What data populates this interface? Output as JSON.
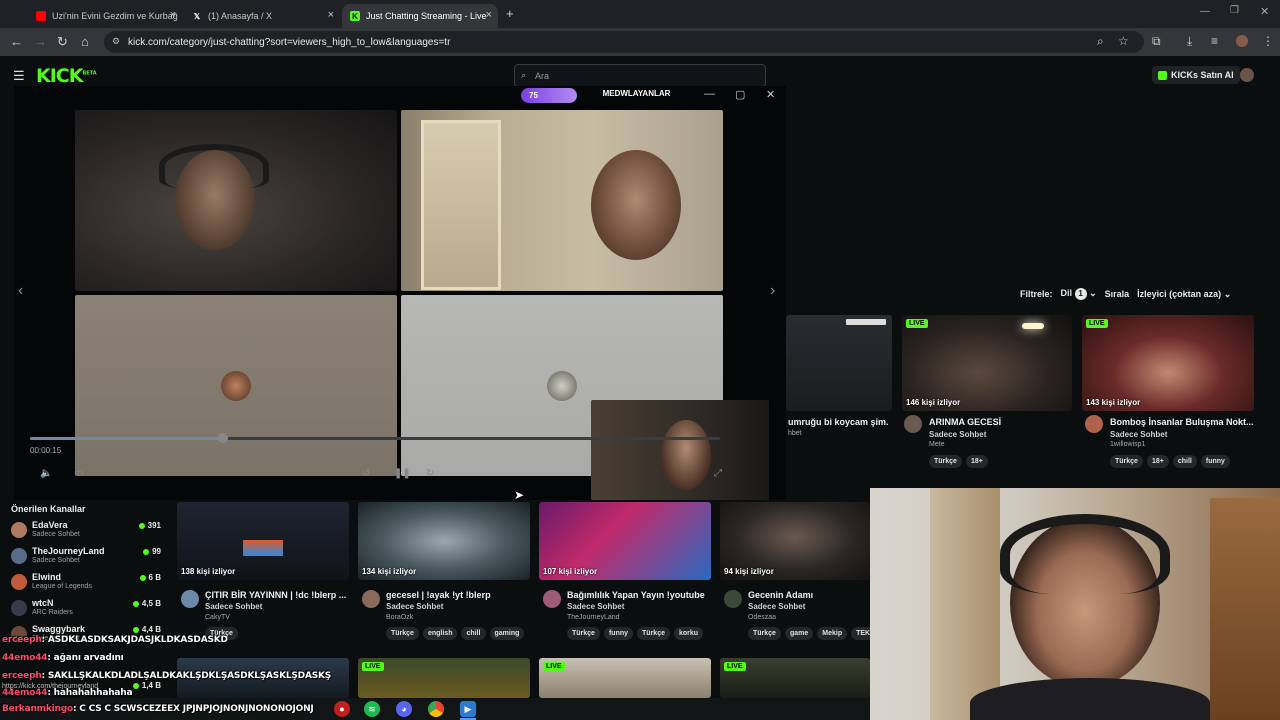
{
  "tabs": [
    {
      "label": "Uzi'nin Evini Gezdim ve Kurbağ",
      "favicon": "youtube-icon"
    },
    {
      "label": "(1) Anasayfa / X",
      "favicon": "x-icon"
    },
    {
      "label": "Just Chatting Streaming - Live",
      "favicon": "kick-icon"
    }
  ],
  "address": {
    "url": "kick.com/category/just-chatting?sort=viewers_high_to_low&languages=tr"
  },
  "kick": {
    "logo": "KICK",
    "logo_sup": "BETA",
    "search_placeholder": "Ara",
    "buy_ai": "KICKs Satın Al"
  },
  "popup": {
    "level_badge": "75",
    "followers_label": "MEDWLAYANLAR",
    "timecode": "00:00:15",
    "progress": 0.28
  },
  "filters": {
    "filter_label": "Filtrele:",
    "lang_label": "Dil",
    "lang_count": "1",
    "sort_label": "Sırala",
    "sort_value": "İzleyici (çoktan aza)"
  },
  "top_cards": [
    {
      "title": "umruğu bi koycam şim...",
      "user": "hbet",
      "category": "",
      "viewers": "",
      "tags": []
    },
    {
      "title": "ARINMA GECESİ",
      "category": "Sadece Sohbet",
      "user": "Mete",
      "viewers": "146 kişi izliyor",
      "live": "LIVE",
      "tags": [
        "Türkçe",
        "18+"
      ]
    },
    {
      "title": "Bomboş İnsanlar Buluşma Nokt...",
      "category": "Sadece Sohbet",
      "user": "1willowisp1",
      "viewers": "143 kişi izliyor",
      "live": "LIVE",
      "tags": [
        "Türkçe",
        "18+",
        "chill",
        "funny"
      ]
    }
  ],
  "bottom_cards": [
    {
      "title": "ÇITIR BİR YAYINNN | !dc !blerp ...",
      "category": "Sadece Sohbet",
      "user": "CakyTV",
      "viewers": "138 kişi izliyor",
      "tags": [
        "Türkçe"
      ]
    },
    {
      "title": "gecesel | !ayak !yt !blerp",
      "category": "Sadece Sohbet",
      "user": "BoraOzk",
      "viewers": "134 kişi izliyor",
      "tags": [
        "Türkçe",
        "english",
        "chill",
        "gaming"
      ]
    },
    {
      "title": "Bağımlılık Yapan Yayın !youtube",
      "category": "Sadece Sohbet",
      "user": "TheJourneyLand",
      "viewers": "107 kişi izliyor",
      "tags": [
        "Türkçe",
        "funny",
        "Türkçe",
        "korku"
      ]
    },
    {
      "title": "Gecenin Adamı",
      "category": "Sadece Sohbet",
      "user": "Odeszaa",
      "viewers": "94 kişi izliyor",
      "tags": [
        "Türkçe",
        "game",
        "Mekip",
        "TEK"
      ]
    }
  ],
  "third_row_live": [
    "LIVE",
    "LIVE",
    "LIVE"
  ],
  "sidebar": {
    "title": "Önerilen Kanallar",
    "channels": [
      {
        "name": "EdaVera",
        "category": "Sadece Sohbet",
        "viewers": "391"
      },
      {
        "name": "TheJourneyLand",
        "category": "Sadece Sohbet",
        "viewers": "99"
      },
      {
        "name": "Elwind",
        "category": "League of Legends",
        "viewers": "6 B"
      },
      {
        "name": "wtcN",
        "category": "ARC Raiders",
        "viewers": "4,5 B"
      },
      {
        "name": "Swaggybark",
        "category": "Sadece Sohbet",
        "viewers": "4,4 B"
      },
      {
        "name": "",
        "category": "",
        "viewers": "1,4 B"
      }
    ]
  },
  "chat": [
    {
      "user": "erceeph",
      "text": ": ASDKLASDKSAKJDASJKLDKASDASKD"
    },
    {
      "user": "44emo44",
      "text": ": ağanı arvadını"
    },
    {
      "user": "erceeph",
      "text": ": SAKLLŞKALKDLADLŞALDKAKLŞDKLŞASDKLŞASKLŞDASKŞ"
    },
    {
      "user": "44emo44",
      "text": ": hahahahhahaha"
    },
    {
      "user": "Berkanmkingo",
      "text": ": C CS C SCWSCEZEEX JPJNPJOJNONJNONONOJONJ"
    }
  ],
  "status_url": "https://kick.com/thejourneyland",
  "colors": {
    "kick_green": "#53fc18",
    "chat_user": "#ff4a6e"
  }
}
